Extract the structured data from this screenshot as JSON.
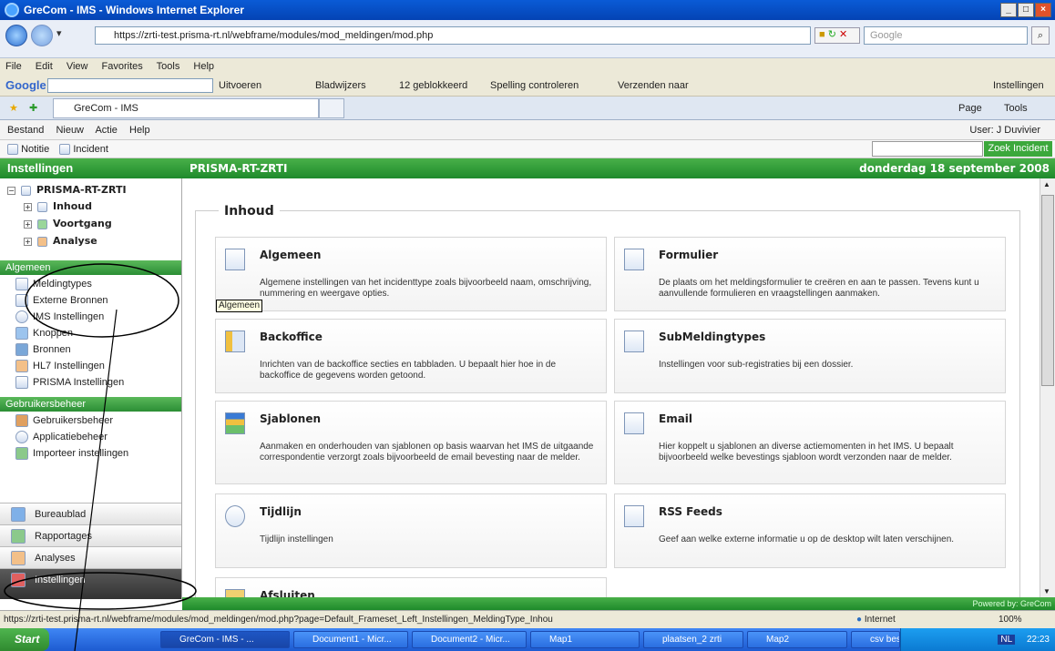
{
  "window": {
    "title": "GreCom - IMS - Windows Internet Explorer"
  },
  "browser": {
    "address": "https://zrti-test.prisma-rt.nl/webframe/modules/mod_meldingen/mod.php",
    "search_placeholder": "Google",
    "menu": [
      "File",
      "Edit",
      "View",
      "Favorites",
      "Tools",
      "Help"
    ],
    "google_toolbar": {
      "brand": "Google",
      "items": [
        "Uitvoeren",
        "Bladwijzers",
        "12 geblokkeerd",
        "Spelling controleren",
        "Verzenden naar"
      ],
      "right": "Instellingen"
    },
    "tab": "GreCom - IMS",
    "tab_tools": [
      "Page",
      "Tools"
    ]
  },
  "app": {
    "menu": [
      "Bestand",
      "Nieuw",
      "Actie",
      "Help"
    ],
    "user": "User: J Duvivier",
    "toolbar": [
      "Notitie",
      "Incident"
    ],
    "search_button": "Zoek Incident",
    "sidebar_title": "Instellingen",
    "main_title": "PRISMA-RT-ZRTI",
    "date": "donderdag 18 september 2008",
    "tree": {
      "root": "PRISMA-RT-ZRTI",
      "children": [
        "Inhoud",
        "Voortgang",
        "Analyse"
      ]
    },
    "sections": [
      {
        "title": "Algemeen",
        "items": [
          "Meldingtypes",
          "Externe Bronnen",
          "IMS Instellingen",
          "Knoppen",
          "Bronnen",
          "HL7 Instellingen",
          "PRISMA Instellingen"
        ]
      },
      {
        "title": "Gebruikersbeheer",
        "items": [
          "Gebruikersbeheer",
          "Applicatiebeheer",
          "Importeer instellingen"
        ]
      }
    ],
    "bottom_nav": [
      "Bureaublad",
      "Rapportages",
      "Analyses",
      "Instellingen"
    ],
    "content_legend": "Inhoud",
    "cards": [
      {
        "title": "Algemeen",
        "desc": "Algemene instellingen van het incidenttype zoals bijvoorbeeld naam, omschrijving, nummering en weergave opties."
      },
      {
        "title": "Formulier",
        "desc": "De plaats om het meldingsformulier te creëren en aan te passen. Tevens kunt u aanvullende formulieren en vraagstellingen aanmaken."
      },
      {
        "title": "Backoffice",
        "desc": "Inrichten van de backoffice secties en tabbladen. U bepaalt hier hoe in de backoffice de gegevens worden getoond."
      },
      {
        "title": "SubMeldingtypes",
        "desc": "Instellingen voor sub-registraties bij een dossier."
      },
      {
        "title": "Sjablonen",
        "desc": "Aanmaken en onderhouden van sjablonen op basis waarvan het IMS de uitgaande correspondentie verzorgt zoals bijvoorbeeld de email bevesting naar de melder."
      },
      {
        "title": "Email",
        "desc": "Hier koppelt u sjablonen an diverse actiemomenten in het IMS. U bepaalt bijvoorbeeld welke bevestings sjabloon wordt verzonden naar de melder."
      },
      {
        "title": "Tijdlijn",
        "desc": "Tijdlijn instellingen"
      },
      {
        "title": "RSS Feeds",
        "desc": "Geef aan welke externe informatie u op de desktop wilt laten verschijnen."
      },
      {
        "title": "Afsluiten",
        "desc": ""
      }
    ],
    "tooltip": "Algemeen",
    "powered": "Powered by: GreCom"
  },
  "status": {
    "url": "https://zrti-test.prisma-rt.nl/webframe/modules/mod_meldingen/mod.php?page=Default_Frameset_Left_Instellingen_MeldingType_Inhou",
    "zone": "Internet",
    "zoom": "100%"
  },
  "taskbar": {
    "start": "Start",
    "buttons": [
      "GreCom - IMS - ...",
      "Document1 - Micr...",
      "Document2 - Micr...",
      "Map1",
      "plaatsen_2 zrti",
      "Map2",
      "csv bestand"
    ],
    "clock": "22:23",
    "lang": "NL"
  }
}
